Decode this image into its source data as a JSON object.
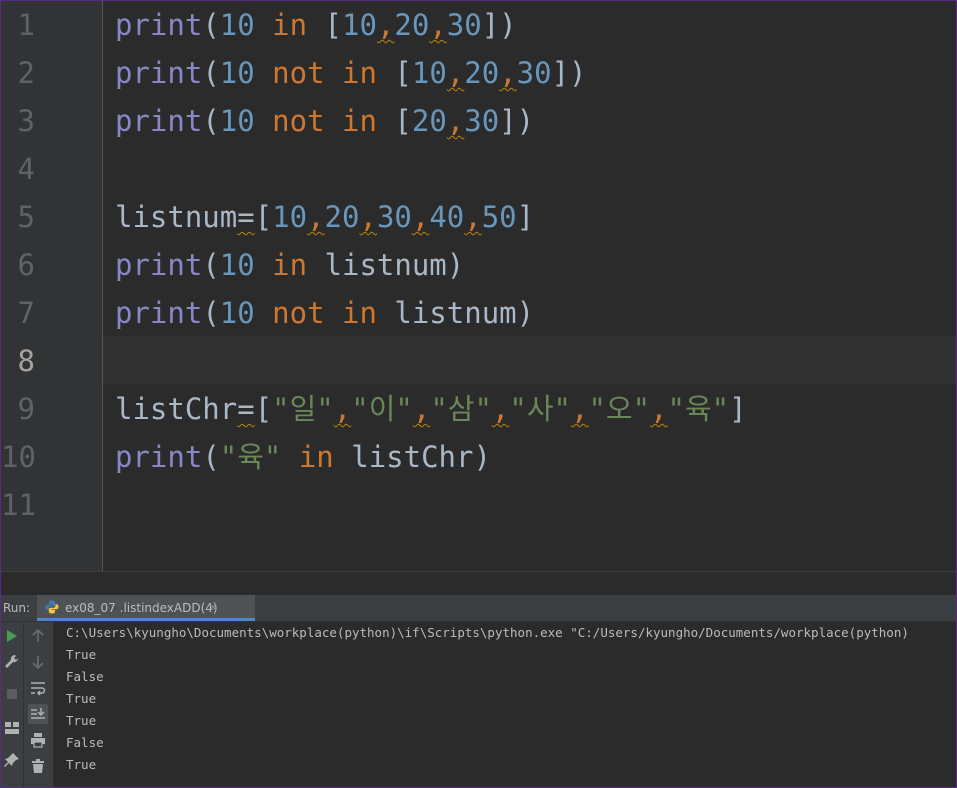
{
  "editor": {
    "line_numbers": [
      "1",
      "2",
      "3",
      "4",
      "5",
      "6",
      "7",
      "8",
      "9",
      "10",
      "11"
    ],
    "active_line": "8",
    "lines": [
      [
        {
          "t": "print",
          "c": "fn"
        },
        {
          "t": "(",
          "c": "plain"
        },
        {
          "t": "10",
          "c": "num"
        },
        {
          "t": " in ",
          "c": "kw"
        },
        {
          "t": "[",
          "c": "plain"
        },
        {
          "t": "10",
          "c": "num"
        },
        {
          "t": ",",
          "c": "comma"
        },
        {
          "t": "20",
          "c": "num"
        },
        {
          "t": ",",
          "c": "comma"
        },
        {
          "t": "30",
          "c": "num"
        },
        {
          "t": "])",
          "c": "plain"
        }
      ],
      [
        {
          "t": "print",
          "c": "fn"
        },
        {
          "t": "(",
          "c": "plain"
        },
        {
          "t": "10",
          "c": "num"
        },
        {
          "t": " not in ",
          "c": "kw"
        },
        {
          "t": "[",
          "c": "plain"
        },
        {
          "t": "10",
          "c": "num"
        },
        {
          "t": ",",
          "c": "comma"
        },
        {
          "t": "20",
          "c": "num"
        },
        {
          "t": ",",
          "c": "comma"
        },
        {
          "t": "30",
          "c": "num"
        },
        {
          "t": "])",
          "c": "plain"
        }
      ],
      [
        {
          "t": "print",
          "c": "fn"
        },
        {
          "t": "(",
          "c": "plain"
        },
        {
          "t": "10",
          "c": "num"
        },
        {
          "t": " not in ",
          "c": "kw"
        },
        {
          "t": "[",
          "c": "plain"
        },
        {
          "t": "20",
          "c": "num"
        },
        {
          "t": ",",
          "c": "comma"
        },
        {
          "t": "30",
          "c": "num"
        },
        {
          "t": "])",
          "c": "plain"
        }
      ],
      [],
      [
        {
          "t": "listnum",
          "c": "plain"
        },
        {
          "t": "=",
          "c": "wavy"
        },
        {
          "t": "[",
          "c": "plain"
        },
        {
          "t": "10",
          "c": "num"
        },
        {
          "t": ",",
          "c": "comma"
        },
        {
          "t": "20",
          "c": "num"
        },
        {
          "t": ",",
          "c": "comma"
        },
        {
          "t": "30",
          "c": "num"
        },
        {
          "t": ",",
          "c": "comma"
        },
        {
          "t": "40",
          "c": "num"
        },
        {
          "t": ",",
          "c": "comma"
        },
        {
          "t": "50",
          "c": "num"
        },
        {
          "t": "]",
          "c": "plain"
        }
      ],
      [
        {
          "t": "print",
          "c": "fn"
        },
        {
          "t": "(",
          "c": "plain"
        },
        {
          "t": "10",
          "c": "num"
        },
        {
          "t": " in ",
          "c": "kw"
        },
        {
          "t": "listnum)",
          "c": "plain"
        }
      ],
      [
        {
          "t": "print",
          "c": "fn"
        },
        {
          "t": "(",
          "c": "plain"
        },
        {
          "t": "10",
          "c": "num"
        },
        {
          "t": " not in ",
          "c": "kw"
        },
        {
          "t": "listnum)",
          "c": "plain"
        }
      ],
      [],
      [
        {
          "t": "listChr",
          "c": "plain"
        },
        {
          "t": "=",
          "c": "wavy"
        },
        {
          "t": "[",
          "c": "plain"
        },
        {
          "t": "\"일\"",
          "c": "str"
        },
        {
          "t": ",",
          "c": "comma"
        },
        {
          "t": "\"이\"",
          "c": "str"
        },
        {
          "t": ",",
          "c": "comma"
        },
        {
          "t": "\"삼\"",
          "c": "str"
        },
        {
          "t": ",",
          "c": "comma"
        },
        {
          "t": "\"사\"",
          "c": "str"
        },
        {
          "t": ",",
          "c": "comma"
        },
        {
          "t": "\"오\"",
          "c": "str"
        },
        {
          "t": ",",
          "c": "comma"
        },
        {
          "t": "\"육\"",
          "c": "str"
        },
        {
          "t": "]",
          "c": "plain"
        }
      ],
      [
        {
          "t": "print",
          "c": "fn"
        },
        {
          "t": "(",
          "c": "plain"
        },
        {
          "t": "\"육\"",
          "c": "str"
        },
        {
          "t": " in ",
          "c": "kw"
        },
        {
          "t": "listChr)",
          "c": "plain"
        }
      ],
      []
    ]
  },
  "run_panel": {
    "label": "Run:",
    "tab_title": "ex08_07 .listindexADD(4)",
    "tab_close": "×",
    "console_lines": [
      "C:\\Users\\kyungho\\Documents\\workplace(python)\\if\\Scripts\\python.exe \"C:/Users/kyungho/Documents/workplace(python)",
      "True",
      "False",
      "True",
      "True",
      "False",
      "True"
    ],
    "left_tools": [
      "run-icon",
      "wrench-icon",
      "stop-icon",
      "layout-icon",
      "pin-icon"
    ],
    "right_tools": [
      "up-arrow-icon",
      "down-arrow-icon",
      "soft-wrap-icon",
      "scroll-to-end-icon",
      "print-icon",
      "trash-icon"
    ]
  }
}
